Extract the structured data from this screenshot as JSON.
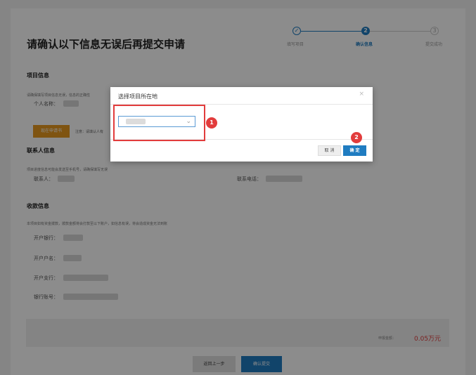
{
  "header": {
    "title": "请确认以下信息无误后再提交申请"
  },
  "steps": [
    {
      "label": "填写项目",
      "state": "done",
      "marker": "✓"
    },
    {
      "label": "确认信息",
      "state": "active",
      "marker": "2"
    },
    {
      "label": "提交成功",
      "state": "todo",
      "marker": "3"
    }
  ],
  "project_section": {
    "title": "项目信息",
    "hint": "请确保填写项目信息无误，信息的正确性",
    "name_label": "个人名称：",
    "button_label": "现在申请书",
    "note": "注意：请填认人有"
  },
  "contact_section": {
    "title": "联系人信息",
    "hint": "项目进度信息可能会发送至手机号，请确保填写无误",
    "contact_label": "联系人：",
    "phone_label": "联系电话："
  },
  "payment_section": {
    "title": "收款信息",
    "hint": "本项目如有资金拨款，拨款金额将会打款至以下账户，如信息有误，将会造成资金无法到账",
    "bank_label": "开户银行：",
    "account_name_label": "开户户名：",
    "branch_label": "开户支行：",
    "account_no_label": "银行账号："
  },
  "total": {
    "label": "申报金额：",
    "value": "0.05万元"
  },
  "footer": {
    "back_label": "返回上一步",
    "submit_label": "确认提交"
  },
  "modal": {
    "title": "选择项目所在地",
    "close": "×",
    "chevron": "⌄",
    "cancel_label": "取 消",
    "confirm_label": "确 定"
  },
  "annotations": {
    "badge_1": "1",
    "badge_2": "2"
  },
  "colors": {
    "accent": "#1f7cc1",
    "highlight": "#e23c3c",
    "orange": "#e8991f",
    "amount": "#e03a3a"
  }
}
